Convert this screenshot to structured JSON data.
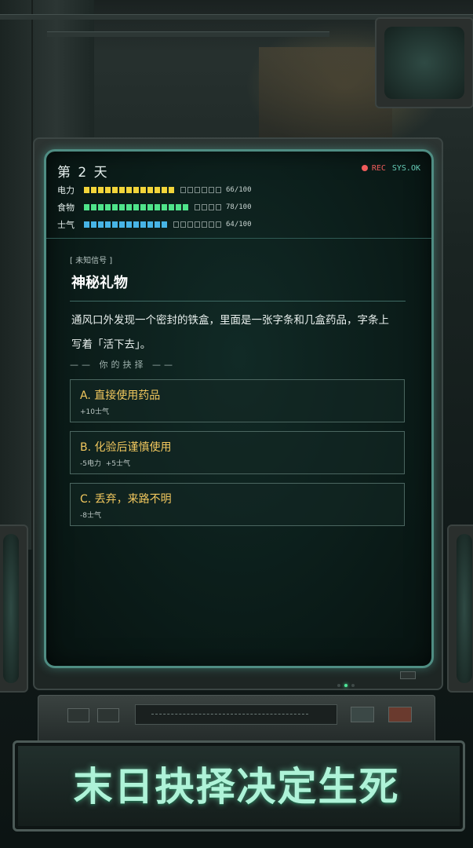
{
  "header": {
    "day_label": "第 2 天",
    "rec_label": "REC",
    "sys_label": "SYS.OK"
  },
  "stats": [
    {
      "label": "电力",
      "value_text": "66/100",
      "value": 66,
      "color": "#f2d43a"
    },
    {
      "label": "食物",
      "value_text": "78/100",
      "value": 78,
      "color": "#4fe38a"
    },
    {
      "label": "士气",
      "value_text": "64/100",
      "value": 64,
      "color": "#47b4e6"
    }
  ],
  "event": {
    "tag": "[ 未知信号 ]",
    "title": "神秘礼物",
    "body_line1": "通风口外发现一个密封的铁盒，里面是一张字条和几盒药品，字条上",
    "body_line2": "写着「活下去」。"
  },
  "choices_header": "—— 你的抉择 ——",
  "choices": [
    {
      "label": "A. 直接使用药品",
      "effect": "+10士气"
    },
    {
      "label": "B. 化验后谨慎使用",
      "effect": "-5电力  +5士气"
    },
    {
      "label": "C. 丢弃，来路不明",
      "effect": "-8士气"
    }
  ],
  "banner": {
    "text": "末日抉择决定生死"
  },
  "colors": {
    "accent": "#4f8d83",
    "choice_text": "#f2c85e",
    "banner_text": "#aef3d8",
    "rec_dot": "#ef5b5b"
  }
}
